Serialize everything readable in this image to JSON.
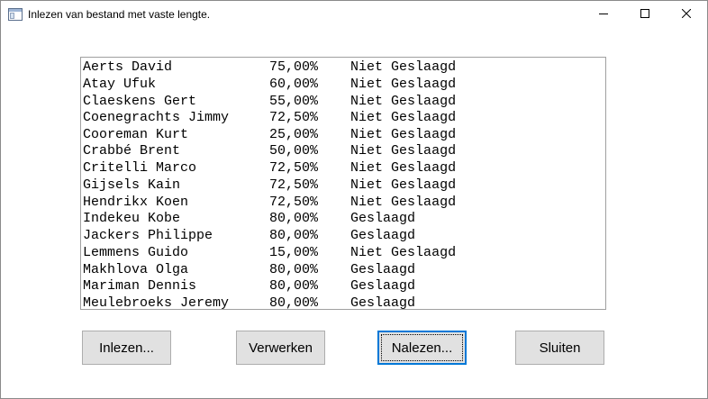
{
  "window": {
    "title": "Inlezen van bestand met vaste lengte.",
    "icon": "form-window-icon",
    "controls": {
      "minimize_icon": "minimize-icon",
      "maximize_icon": "maximize-icon",
      "close_icon": "close-icon"
    }
  },
  "listbox": {
    "items": [
      "Aerts David            75,00%    Niet Geslaagd",
      "Atay Ufuk              60,00%    Niet Geslaagd",
      "Claeskens Gert         55,00%    Niet Geslaagd",
      "Coenegrachts Jimmy     72,50%    Niet Geslaagd",
      "Cooreman Kurt          25,00%    Niet Geslaagd",
      "Crabbé Brent           50,00%    Niet Geslaagd",
      "Critelli Marco         72,50%    Niet Geslaagd",
      "Gijsels Kain           72,50%    Niet Geslaagd",
      "Hendrikx Koen          72,50%    Niet Geslaagd",
      "Indekeu Kobe           80,00%    Geslaagd",
      "Jackers Philippe       80,00%    Geslaagd",
      "Lemmens Guido          15,00%    Niet Geslaagd",
      "Makhlova Olga          80,00%    Geslaagd",
      "Mariman Dennis         80,00%    Geslaagd",
      "Meulebroeks Jeremy     80,00%    Geslaagd"
    ]
  },
  "buttons": {
    "inlezen": "Inlezen...",
    "verwerken": "Verwerken",
    "nalezen": "Nalezen...",
    "sluiten": "Sluiten"
  },
  "colors": {
    "button_face": "#e1e1e1",
    "button_border": "#adadad",
    "focus_accent": "#0078d7",
    "list_border": "#a0a0a0"
  }
}
